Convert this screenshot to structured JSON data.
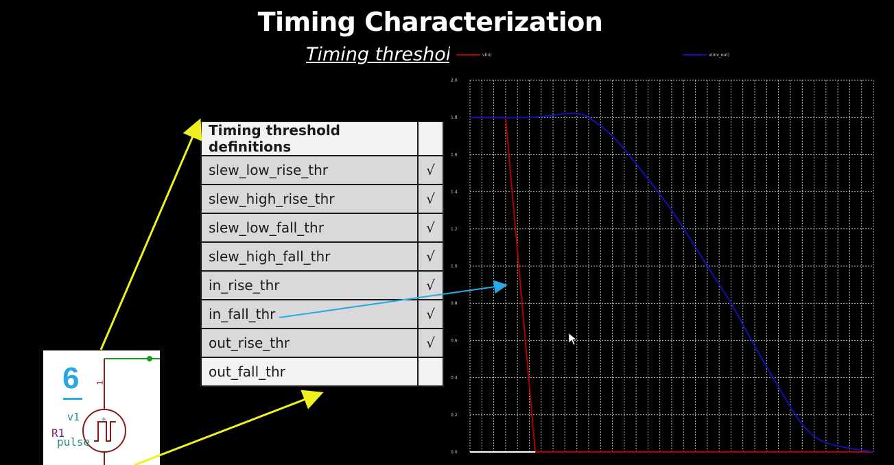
{
  "slide": {
    "title": "Timing Characterization",
    "subtitle": "Timing threshold"
  },
  "table": {
    "header": "Timing threshold definitions",
    "rows": [
      {
        "name": "slew_low_rise_thr",
        "check": "√"
      },
      {
        "name": "slew_high_rise_thr",
        "check": "√"
      },
      {
        "name": "slew_low_fall_thr",
        "check": "√"
      },
      {
        "name": "slew_high_fall_thr",
        "check": "√"
      },
      {
        "name": "in_rise_thr",
        "check": "√"
      },
      {
        "name": "in_fall_thr",
        "check": "√"
      },
      {
        "name": "out_rise_thr",
        "check": "√"
      },
      {
        "name": "out_fall_thr",
        "check": ""
      }
    ]
  },
  "plot": {
    "legend": [
      "v(in)",
      "v(inv_out)"
    ],
    "colors": {
      "in": "#b00000",
      "out": "#1010b8",
      "grid": "#bbbbbb",
      "callout": "#2aa8e8",
      "arrow_yellow": "#f0f020"
    },
    "y_ticks": [
      "2.0",
      "1.8",
      "1.6",
      "1.4",
      "1.2",
      "1.0",
      "0.8",
      "0.6",
      "0.4",
      "0.2",
      "0.0"
    ],
    "x_gridlines": 34
  },
  "chart_data": {
    "type": "line",
    "ylim": [
      0,
      2.0
    ],
    "xlim": [
      0,
      34
    ],
    "grid": true,
    "legend_position": "top",
    "series": [
      {
        "name": "v(in)",
        "x": [
          0,
          3,
          5.5,
          34
        ],
        "y": [
          1.8,
          1.8,
          0.0,
          0.0
        ]
      },
      {
        "name": "v(inv_out)",
        "x": [
          0,
          5,
          8,
          9,
          10,
          12,
          14,
          17,
          20,
          22,
          24,
          26,
          28,
          30,
          34
        ],
        "y": [
          1.8,
          1.8,
          1.82,
          1.82,
          1.8,
          1.7,
          1.55,
          1.3,
          1.0,
          0.8,
          0.57,
          0.35,
          0.15,
          0.05,
          0.0
        ]
      }
    ]
  },
  "schematic": {
    "number": "6",
    "source_label": "v1",
    "resistor_label": "R1",
    "source_type": "pulse",
    "pin_label": "1"
  }
}
